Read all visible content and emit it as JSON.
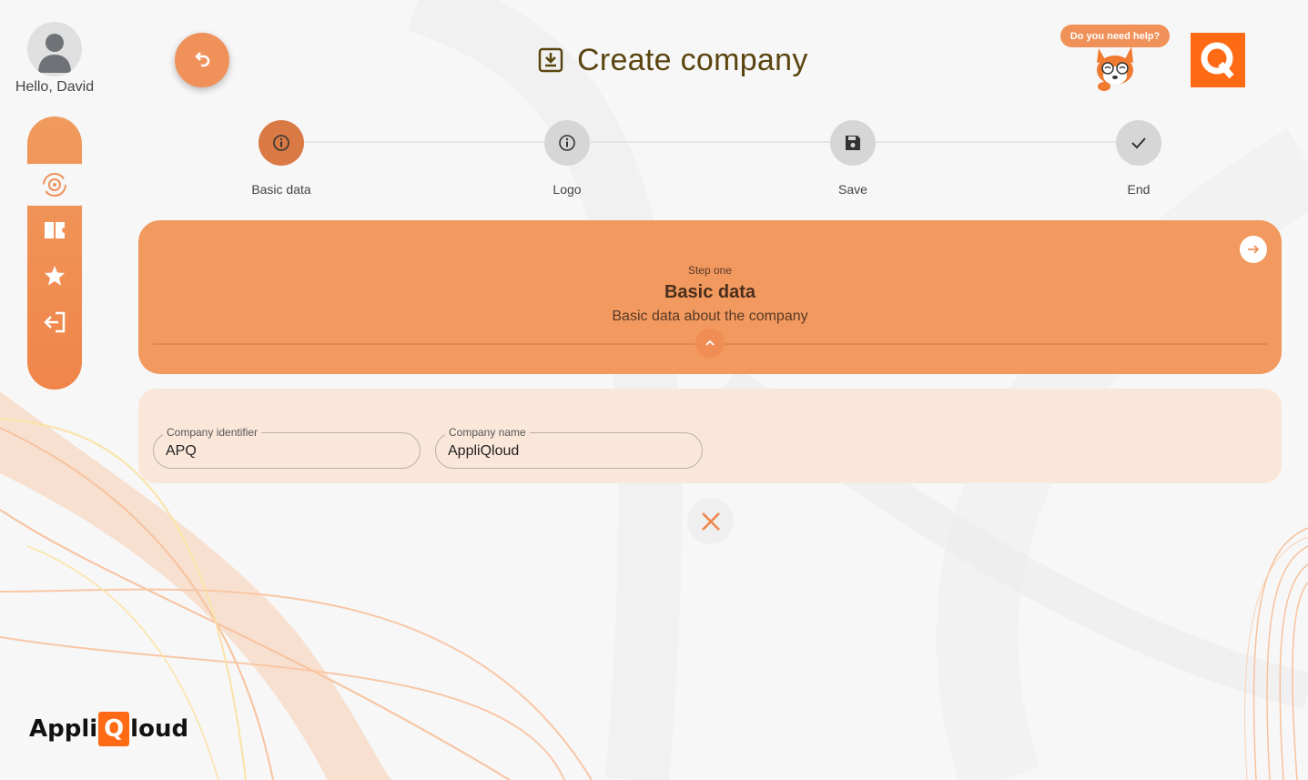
{
  "user": {
    "greeting": "Hello, David"
  },
  "header": {
    "title": "Create company"
  },
  "help": {
    "label": "Do you need help?"
  },
  "brand": {
    "q_letter": "Q",
    "logo_prefix": "Appli",
    "logo_box": "Q",
    "logo_suffix": "loud"
  },
  "stepper": {
    "steps": [
      {
        "label": "Basic data",
        "icon": "info-icon",
        "active": true
      },
      {
        "label": "Logo",
        "icon": "info-icon",
        "active": false
      },
      {
        "label": "Save",
        "icon": "save-icon",
        "active": false
      },
      {
        "label": "End",
        "icon": "check-icon",
        "active": false
      }
    ]
  },
  "step_panel": {
    "subtitle": "Step one",
    "heading": "Basic data",
    "description": "Basic data about the company"
  },
  "form": {
    "identifier": {
      "label": "Company identifier",
      "value": "APQ"
    },
    "name": {
      "label": "Company name",
      "value": "AppliQloud"
    }
  },
  "sidebar": {
    "items": [
      {
        "icon": "settings-sync-icon",
        "active": true
      },
      {
        "icon": "ticket-icon",
        "active": false
      },
      {
        "icon": "star-icon",
        "active": false
      },
      {
        "icon": "logout-icon",
        "active": false
      }
    ]
  },
  "colors": {
    "accent": "#f1995f",
    "accent_dark": "#d97a45",
    "brand_orange": "#ff6a14",
    "form_bg": "#fbe7da",
    "title": "#5a4510"
  }
}
